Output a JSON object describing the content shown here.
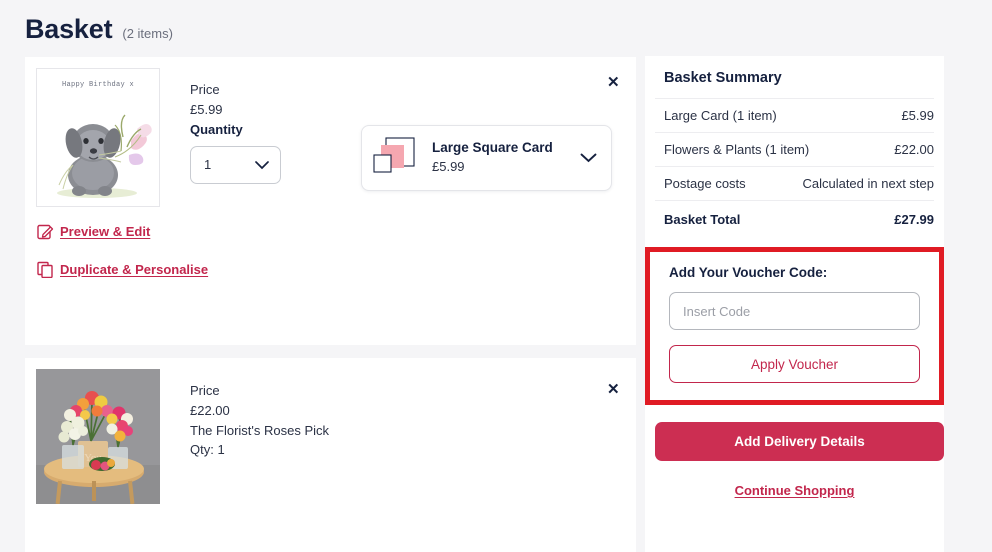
{
  "header": {
    "title": "Basket",
    "item_count": "(2 items)"
  },
  "items": [
    {
      "price_label": "Price",
      "price": "£5.99",
      "quantity_label": "Quantity",
      "quantity_value": "1",
      "thumb_greeting": "Happy Birthday x",
      "remove_icon": "✕",
      "size_option": {
        "name": "Large Square Card",
        "price": "£5.99",
        "chevron": "chevron-down"
      },
      "links": [
        {
          "icon": "edit-icon",
          "label": "Preview & Edit"
        },
        {
          "icon": "duplicate-icon",
          "label": "Duplicate & Personalise"
        }
      ]
    },
    {
      "price_label": "Price",
      "price": "£22.00",
      "name": "The Florist's Roses Pick",
      "qty_text": "Qty: 1",
      "remove_icon": "✕"
    }
  ],
  "summary": {
    "title": "Basket Summary",
    "rows": [
      {
        "label": "Large Card (1 item)",
        "amount": "£5.99"
      },
      {
        "label": "Flowers & Plants (1 item)",
        "amount": "£22.00"
      },
      {
        "label": "Postage costs",
        "amount": "Calculated in next step"
      }
    ],
    "total": {
      "label": "Basket Total",
      "amount": "£27.99"
    },
    "voucher": {
      "title": "Add Your Voucher Code:",
      "input_placeholder": "Insert Code",
      "input_value": "",
      "apply_label": "Apply Voucher"
    },
    "delivery_label": "Add Delivery Details",
    "continue_label": "Continue Shopping"
  },
  "colors": {
    "brand_crimson": "#c2264c",
    "button_crimson": "#cc2e52",
    "navy": "#16213f",
    "annotation_red": "#e01b24",
    "page_bg": "#f5f5f7",
    "card_pink": "#f5a7b0"
  }
}
